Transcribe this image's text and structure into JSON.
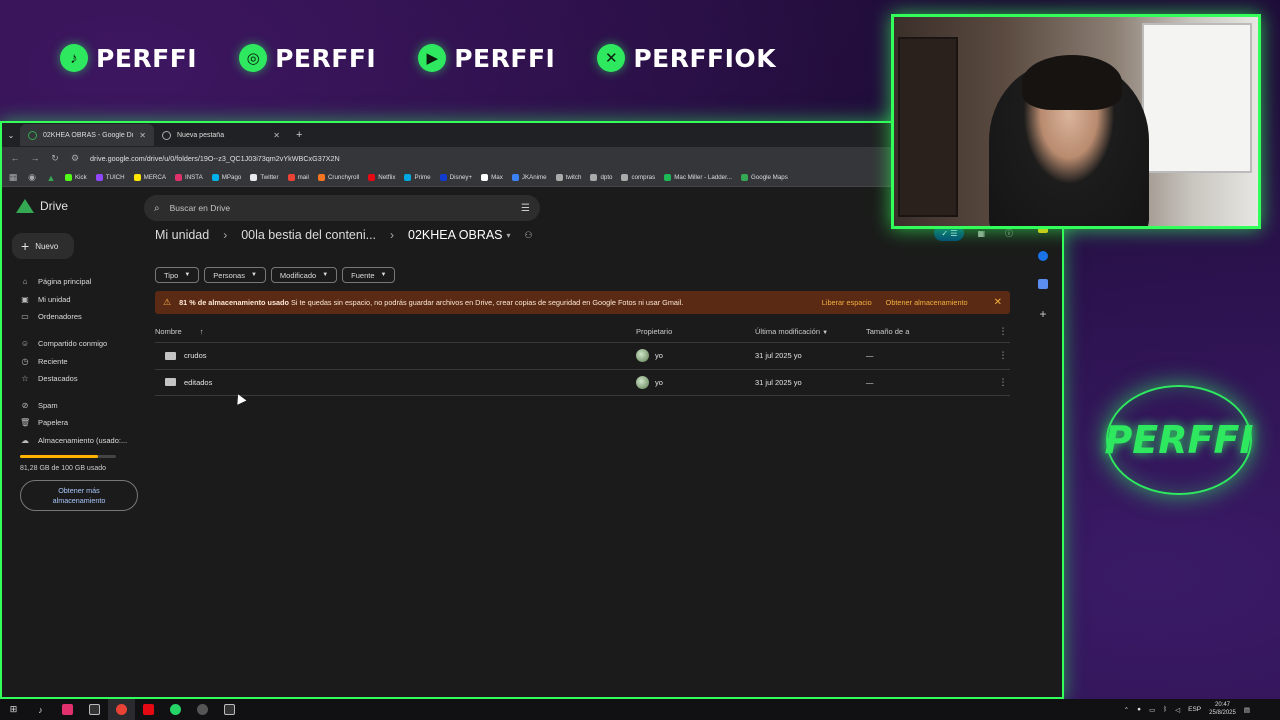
{
  "overlay": {
    "socials": [
      {
        "icon": "tiktok-icon",
        "glyph": "♪",
        "name": "PERFFI"
      },
      {
        "icon": "instagram-icon",
        "glyph": "◎",
        "name": "PERFFI"
      },
      {
        "icon": "youtube-icon",
        "glyph": "▶",
        "name": "PERFFI"
      },
      {
        "icon": "x-icon",
        "glyph": "✕",
        "name": "PERFFIOK"
      }
    ],
    "logo_text": "PERFFI",
    "accent": "#32ff5a"
  },
  "browser": {
    "tabs": [
      {
        "label": "02KHEA OBRAS - Google Drive",
        "active": true
      },
      {
        "label": "Nueva pestaña",
        "active": false
      }
    ],
    "url": "drive.google.com/drive/u/0/folders/19O--z3_QC1J03i73qm2vYkWBCxG37X2N",
    "bookmarks": [
      {
        "label": "Kick",
        "color": "#53fc18"
      },
      {
        "label": "TUICH",
        "color": "#9146ff"
      },
      {
        "label": "MERCA",
        "color": "#ffe600"
      },
      {
        "label": "INSTA",
        "color": "#e1306c"
      },
      {
        "label": "MPago",
        "color": "#00b1ea"
      },
      {
        "label": "Twitter",
        "color": "#e7e9ea"
      },
      {
        "label": "mail",
        "color": "#ea4335"
      },
      {
        "label": "Crunchyroll",
        "color": "#f47521"
      },
      {
        "label": "Netflix",
        "color": "#e50914"
      },
      {
        "label": "Prime",
        "color": "#00a8e1"
      },
      {
        "label": "Disney+",
        "color": "#113ccf"
      },
      {
        "label": "Max",
        "color": "#ffffff"
      },
      {
        "label": "JKAnime",
        "color": "#3b82f6"
      },
      {
        "label": "twitch",
        "color": "#aaaaaa"
      },
      {
        "label": "dpto",
        "color": "#aaaaaa"
      },
      {
        "label": "compras",
        "color": "#aaaaaa"
      },
      {
        "label": "Mac Miller - Ladder...",
        "color": "#1db954"
      },
      {
        "label": "Google Maps",
        "color": "#34a853"
      }
    ]
  },
  "drive": {
    "logo_label": "Drive",
    "search_placeholder": "Buscar en Drive",
    "new_label": "Nuevo",
    "nav": [
      {
        "icon": "home-icon",
        "glyph": "⌂",
        "label": "Página principal"
      },
      {
        "icon": "my-drive-icon",
        "glyph": "▣",
        "label": "Mi unidad"
      },
      {
        "icon": "computers-icon",
        "glyph": "▭",
        "label": "Ordenadores"
      },
      {
        "icon": "shared-icon",
        "glyph": "☺",
        "label": "Compartido conmigo"
      },
      {
        "icon": "recent-icon",
        "glyph": "◷",
        "label": "Reciente"
      },
      {
        "icon": "star-icon",
        "glyph": "☆",
        "label": "Destacados"
      },
      {
        "icon": "spam-icon",
        "glyph": "⊘",
        "label": "Spam"
      },
      {
        "icon": "trash-icon",
        "glyph": "🗑",
        "label": "Papelera"
      },
      {
        "icon": "cloud-icon",
        "glyph": "☁",
        "label": "Almacenamiento (usado:..."
      }
    ],
    "storage_used_fraction": 0.81,
    "storage_text": "81,28 GB de 100 GB usado",
    "get_storage_label": "Obtener más almacenamiento",
    "breadcrumb": [
      "Mi unidad",
      "00la bestia del conteni...",
      "02KHEA OBRAS"
    ],
    "filters": [
      "Tipo",
      "Personas",
      "Modificado",
      "Fuente"
    ],
    "warning": {
      "bold": "81 % de almacenamiento usado",
      "text": " Si te quedas sin espacio, no podrás guardar archivos en Drive, crear copias de seguridad en Google Fotos ni usar Gmail.",
      "action1": "Liberar espacio",
      "action2": "Obtener almacenamiento"
    },
    "columns": {
      "name": "Nombre",
      "owner": "Propietario",
      "modified": "Última modificación",
      "size": "Tamaño de a"
    },
    "rows": [
      {
        "name": "crudos",
        "owner": "yo",
        "modified": "31 jul 2025 yo",
        "size": "—"
      },
      {
        "name": "editados",
        "owner": "yo",
        "modified": "31 jul 2025 yo",
        "size": "—"
      }
    ]
  },
  "taskbar": {
    "language": "ESP",
    "time": "20:47",
    "date": "25/8/2025"
  }
}
